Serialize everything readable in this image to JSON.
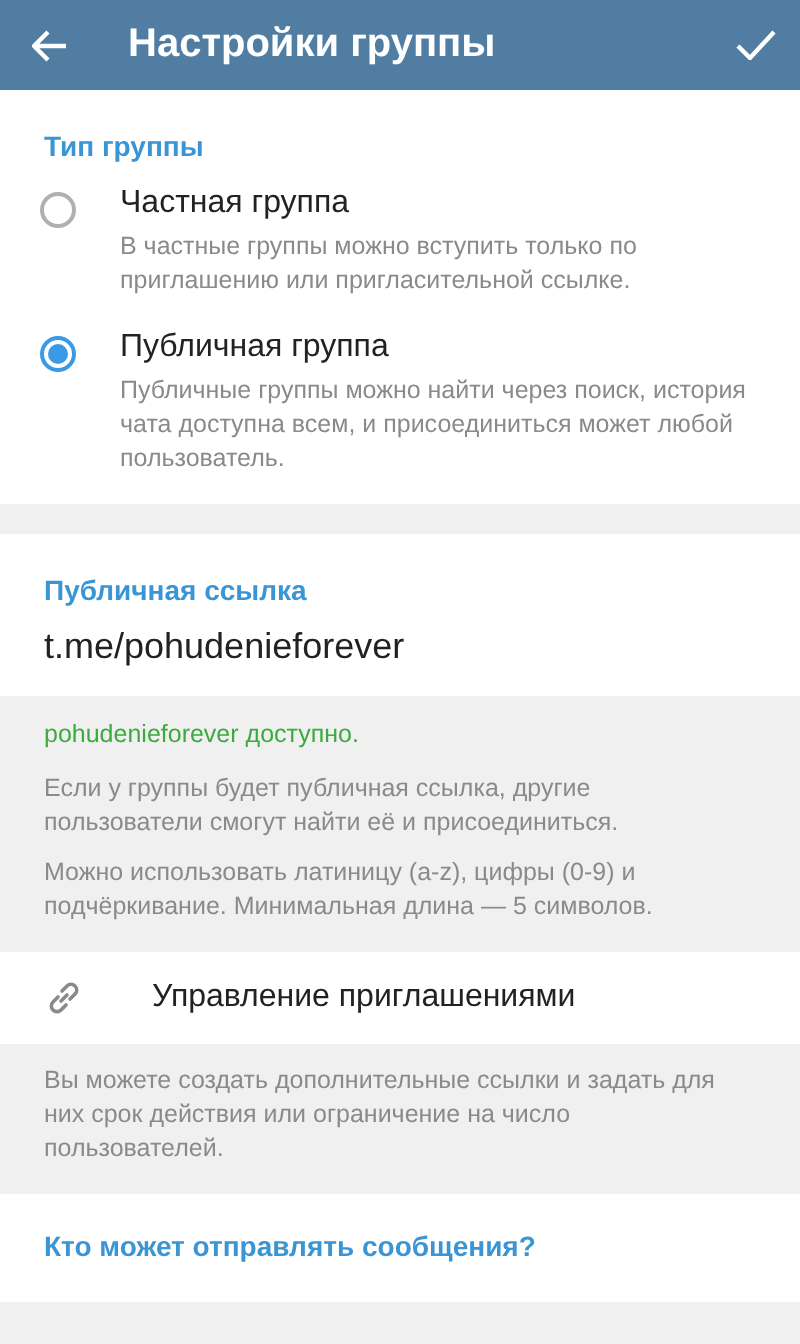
{
  "app_bar": {
    "title": "Настройки группы"
  },
  "group_type": {
    "heading": "Тип группы",
    "options": [
      {
        "label": "Частная группа",
        "description": "В частные группы можно вступить только по приглашению или пригласительной ссылке.",
        "selected": false
      },
      {
        "label": "Публичная группа",
        "description": "Публичные группы можно найти через поиск, история чата доступна всем, и присоединиться может любой пользователь.",
        "selected": true
      }
    ]
  },
  "public_link": {
    "heading": "Публичная ссылка",
    "value": "t.me/pohudenieforever"
  },
  "link_status": "pohudenieforever доступно.",
  "link_info": [
    "Если у группы будет публичная ссылка, другие пользователи смогут найти её и присоединиться.",
    "Можно использовать латиницу (a-z), цифры (0-9) и подчёркивание. Минимальная длина — 5 символов."
  ],
  "invites": {
    "label": "Управление приглашениями",
    "description": "Вы можете создать дополнительные ссылки и задать для них срок действия или ограничение на число пользователей."
  },
  "next_section": {
    "heading": "Кто может отправлять сообщения?"
  }
}
